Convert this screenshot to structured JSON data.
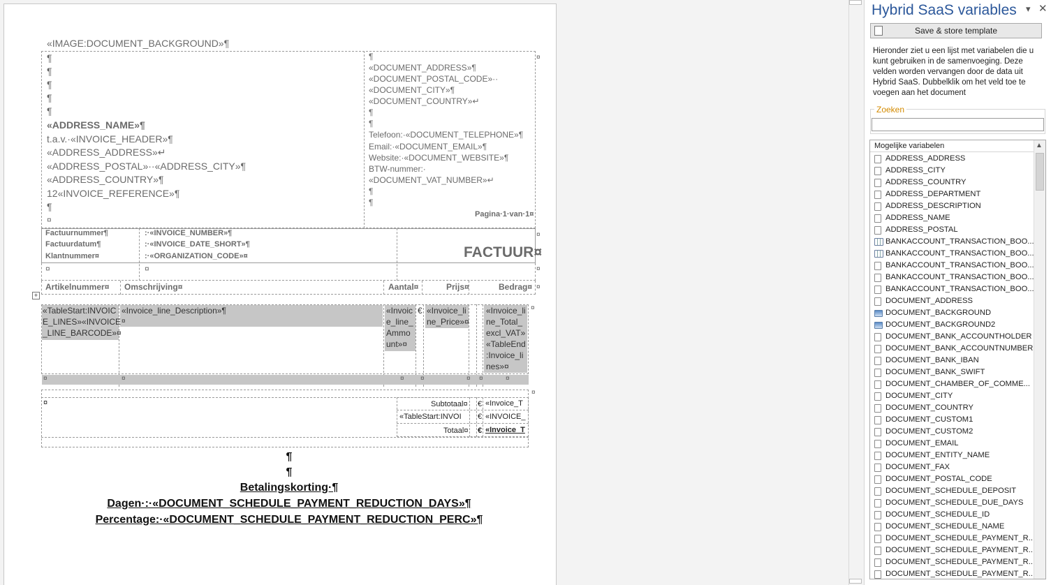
{
  "document": {
    "background_field": "«IMAGE:DOCUMENT_BACKGROUND»¶",
    "left_lines": [
      "¶",
      "¶",
      "¶",
      "¶",
      "¶"
    ],
    "address_name": "«ADDRESS_NAME»¶",
    "tav": "t.a.v.·«INVOICE_HEADER»¶",
    "address_address": "«ADDRESS_ADDRESS»↵",
    "address_postal_city": "«ADDRESS_POSTAL»··«ADDRESS_CITY»¶",
    "address_country": "«ADDRESS_COUNTRY»¶",
    "invoice_reference": "12«INVOICE_REFERENCE»¶",
    "after_ref": "¶",
    "cell_end": "¤",
    "right_block": {
      "first": "¶",
      "address": "«DOCUMENT_ADDRESS»¶",
      "postal": "«DOCUMENT_POSTAL_CODE»··",
      "city": "«DOCUMENT_CITY»¶",
      "country": "«DOCUMENT_COUNTRY»↵",
      "blank1": "¶",
      "blank2": "¶",
      "telephone": "Telefoon:·«DOCUMENT_TELEPHONE»¶",
      "email": "Email:·«DOCUMENT_EMAIL»¶",
      "website": "Website:·«DOCUMENT_WEBSITE»¶",
      "btw": "BTW-nummer:·",
      "vat": "«DOCUMENT_VAT_NUMBER»↵",
      "blank3": "¶",
      "blank4": "¶",
      "page": "Pagina·1·van·1¤"
    },
    "header_labels": [
      "Factuurnummer¶",
      "Factuurdatum¶",
      "Klantnummer¤"
    ],
    "header_values": [
      ":·«INVOICE_NUMBER»¶",
      ":·«INVOICE_DATE_SHORT»¶",
      ":·«ORGANIZATION_CODE»¤"
    ],
    "factuur_title": "FACTUUR¤",
    "columns": {
      "artikel": "Artikelnummer¤",
      "omschrijving": "Omschrijving¤",
      "aantal": "Aantal¤",
      "prijs": "Prijs¤",
      "bedrag": "Bedrag¤"
    },
    "rows": {
      "barcode": "«TableStart:INVOIC\nE_LINES»«INVOICE\n_LINE_BARCODE»¤",
      "description": "«Invoice_line_Description»¶",
      "description_end": "¤",
      "amount": "«Invoic\ne_line_\nAmmo\nunt»¤",
      "euro1": "€",
      "price": "«Invoice_li\nne_Price»¤",
      "total": "«Invoice_li\nne_Total_\nexcl_VAT»\n«TableEnd\n:Invoice_li\nnes»¤"
    },
    "totals": {
      "subtotal_label": "Subtotaal¤",
      "subtotal_value": "«Invoice_T",
      "vat_label": "«TableStart:INVOI",
      "vat_value": "«INVOICE_",
      "total_label": "Totaal¤",
      "total_value": "«Invoice_T",
      "euro": "€"
    },
    "footer": {
      "blank1": "¶",
      "blank2": "¶",
      "korting": "Betalingskorting·¶",
      "dagen": "Dagen·:·«DOCUMENT_SCHEDULE_PAYMENT_REDUCTION_DAYS»¶",
      "percentage": "Percentage:·«DOCUMENT_SCHEDULE_PAYMENT_REDUCTION_PERC»¶"
    }
  },
  "pane": {
    "title": "Hybrid SaaS variables",
    "save_button": "Save & store template",
    "description": "Hieronder ziet u een lijst met variabelen die u kunt gebruiken in de samenvoeging. Deze velden worden vervangen door de data uit Hybrid SaaS. Dubbelklik om het veld toe te voegen aan het document",
    "search_label": "Zoeken",
    "search_value": "",
    "list_header": "Mogelijke variabelen",
    "items": [
      {
        "label": "ADDRESS_ADDRESS",
        "icon": "field"
      },
      {
        "label": "ADDRESS_CITY",
        "icon": "field"
      },
      {
        "label": "ADDRESS_COUNTRY",
        "icon": "field"
      },
      {
        "label": "ADDRESS_DEPARTMENT",
        "icon": "field"
      },
      {
        "label": "ADDRESS_DESCRIPTION",
        "icon": "field"
      },
      {
        "label": "ADDRESS_NAME",
        "icon": "field"
      },
      {
        "label": "ADDRESS_POSTAL",
        "icon": "field"
      },
      {
        "label": "BANKACCOUNT_TRANSACTION_BOO...",
        "icon": "table"
      },
      {
        "label": "BANKACCOUNT_TRANSACTION_BOO...",
        "icon": "table"
      },
      {
        "label": "BANKACCOUNT_TRANSACTION_BOO...",
        "icon": "field"
      },
      {
        "label": "BANKACCOUNT_TRANSACTION_BOO...",
        "icon": "field"
      },
      {
        "label": "BANKACCOUNT_TRANSACTION_BOO...",
        "icon": "field"
      },
      {
        "label": "DOCUMENT_ADDRESS",
        "icon": "field"
      },
      {
        "label": "DOCUMENT_BACKGROUND",
        "icon": "image"
      },
      {
        "label": "DOCUMENT_BACKGROUND2",
        "icon": "image"
      },
      {
        "label": "DOCUMENT_BANK_ACCOUNTHOLDER",
        "icon": "field"
      },
      {
        "label": "DOCUMENT_BANK_ACCOUNTNUMBER",
        "icon": "field"
      },
      {
        "label": "DOCUMENT_BANK_IBAN",
        "icon": "field"
      },
      {
        "label": "DOCUMENT_BANK_SWIFT",
        "icon": "field"
      },
      {
        "label": "DOCUMENT_CHAMBER_OF_COMME...",
        "icon": "field"
      },
      {
        "label": "DOCUMENT_CITY",
        "icon": "field"
      },
      {
        "label": "DOCUMENT_COUNTRY",
        "icon": "field"
      },
      {
        "label": "DOCUMENT_CUSTOM1",
        "icon": "field"
      },
      {
        "label": "DOCUMENT_CUSTOM2",
        "icon": "field"
      },
      {
        "label": "DOCUMENT_EMAIL",
        "icon": "field"
      },
      {
        "label": "DOCUMENT_ENTITY_NAME",
        "icon": "field"
      },
      {
        "label": "DOCUMENT_FAX",
        "icon": "field"
      },
      {
        "label": "DOCUMENT_POSTAL_CODE",
        "icon": "field"
      },
      {
        "label": "DOCUMENT_SCHEDULE_DEPOSIT",
        "icon": "field"
      },
      {
        "label": "DOCUMENT_SCHEDULE_DUE_DAYS",
        "icon": "field"
      },
      {
        "label": "DOCUMENT_SCHEDULE_ID",
        "icon": "field"
      },
      {
        "label": "DOCUMENT_SCHEDULE_NAME",
        "icon": "field"
      },
      {
        "label": "DOCUMENT_SCHEDULE_PAYMENT_R...",
        "icon": "field"
      },
      {
        "label": "DOCUMENT_SCHEDULE_PAYMENT_R...",
        "icon": "field"
      },
      {
        "label": "DOCUMENT_SCHEDULE_PAYMENT_R...",
        "icon": "field"
      },
      {
        "label": "DOCUMENT_SCHEDULE_PAYMENT_R...",
        "icon": "field"
      }
    ]
  }
}
